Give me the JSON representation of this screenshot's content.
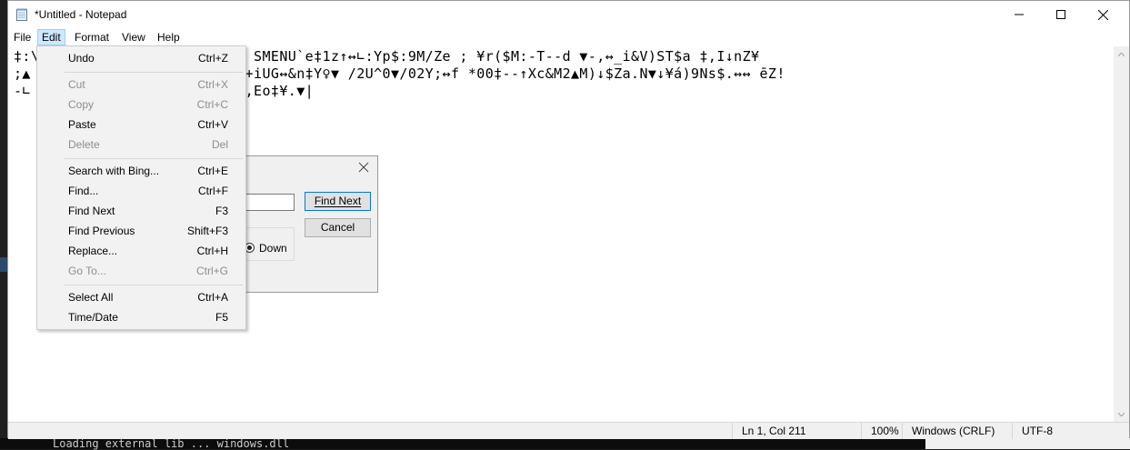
{
  "window": {
    "title": "*Untitled - Notepad",
    "icon": "notepad-icon",
    "controls": [
      "minimize-icon",
      "maximize-icon",
      "close-icon"
    ]
  },
  "menubar": {
    "file": "File",
    "edit": "Edit",
    "format": "Format",
    "view": "View",
    "help": "Help"
  },
  "editor": {
    "lines": [
      "‡:\\                     G∟1 SMENU`e‡1z↑↔∟:Yp$:9M/Ze ; ¥r($M:-T--d ▼-,↔_i&V)ST$a ‡,I↓nZ¥",
      ";▲                    <Tm$-+iUG↔&n‡Y♀▼ /2U^0▼/02Y;↔f *00‡--↑Xc&M2▲M)↓$Za.N▼↓¥á)9Ns$.↔↔ ēZ!",
      "-∟                    ▼<1Z▲,Eo‡¥.▼|"
    ]
  },
  "find_dialog": {
    "find_next_label": "Find Next",
    "cancel_label": "Cancel",
    "direction_label": "n",
    "down_label": "Down"
  },
  "edit_menu": {
    "undo": {
      "label": "Undo",
      "shortcut": "Ctrl+Z"
    },
    "cut": {
      "label": "Cut",
      "shortcut": "Ctrl+X"
    },
    "copy": {
      "label": "Copy",
      "shortcut": "Ctrl+C"
    },
    "paste": {
      "label": "Paste",
      "shortcut": "Ctrl+V"
    },
    "delete": {
      "label": "Delete",
      "shortcut": "Del"
    },
    "search_bing": {
      "label": "Search with Bing...",
      "shortcut": "Ctrl+E"
    },
    "find": {
      "label": "Find...",
      "shortcut": "Ctrl+F"
    },
    "find_next": {
      "label": "Find Next",
      "shortcut": "F3"
    },
    "find_previous": {
      "label": "Find Previous",
      "shortcut": "Shift+F3"
    },
    "replace": {
      "label": "Replace...",
      "shortcut": "Ctrl+H"
    },
    "goto": {
      "label": "Go To...",
      "shortcut": "Ctrl+G"
    },
    "select_all": {
      "label": "Select All",
      "shortcut": "Ctrl+A"
    },
    "time_date": {
      "label": "Time/Date",
      "shortcut": "F5"
    }
  },
  "statusbar": {
    "position": "Ln 1, Col 211",
    "zoom": "100%",
    "line_ending": "Windows (CRLF)",
    "encoding": "UTF-8"
  },
  "background": {
    "terminal_text": "Loading external lib ... windows.dll"
  }
}
